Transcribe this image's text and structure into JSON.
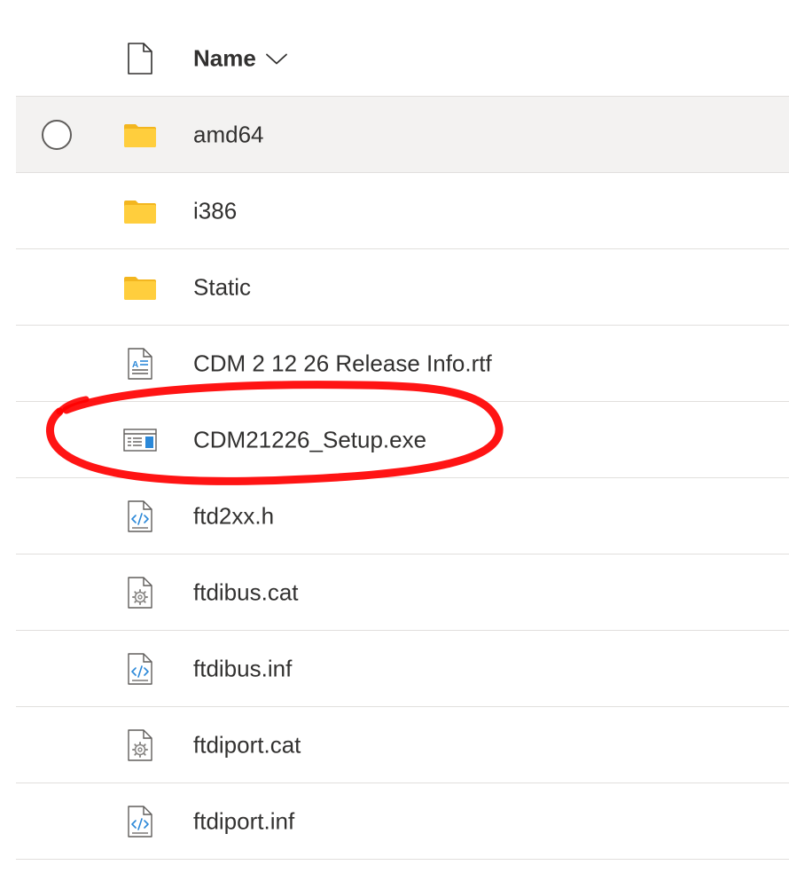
{
  "header": {
    "name_label": "Name",
    "file_type_icon": "document-icon",
    "sort_icon": "chevron-down-icon"
  },
  "files": [
    {
      "name": "amd64",
      "icon": "folder-icon",
      "hovered": true
    },
    {
      "name": "i386",
      "icon": "folder-icon"
    },
    {
      "name": "Static",
      "icon": "folder-icon"
    },
    {
      "name": "CDM 2 12 26 Release Info.rtf",
      "icon": "rtf-document-icon"
    },
    {
      "name": "CDM21226_Setup.exe",
      "icon": "executable-icon"
    },
    {
      "name": "ftd2xx.h",
      "icon": "code-file-icon"
    },
    {
      "name": "ftdibus.cat",
      "icon": "settings-file-icon"
    },
    {
      "name": "ftdibus.inf",
      "icon": "code-file-icon"
    },
    {
      "name": "ftdiport.cat",
      "icon": "settings-file-icon"
    },
    {
      "name": "ftdiport.inf",
      "icon": "code-file-icon"
    }
  ],
  "colors": {
    "folder": "#FFCE3D",
    "folder_tab": "#F3B61F",
    "accent_blue": "#2B88D8",
    "annotation_red": "#FF0000",
    "hover_bg": "#F3F2F1",
    "divider": "#E1DFDD"
  }
}
